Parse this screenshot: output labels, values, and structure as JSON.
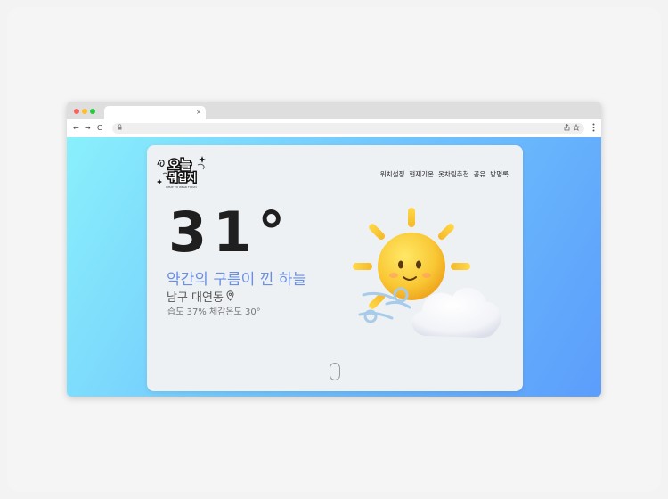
{
  "browser": {
    "tab_close": "×",
    "nav_back": "←",
    "nav_forward": "→",
    "nav_reload": "C",
    "url_icon": "lock-icon",
    "toolbar_icons": [
      "share-icon",
      "star-icon",
      "menu-dots-icon"
    ]
  },
  "site": {
    "logo": {
      "title_line1": "오늘",
      "title_line2": "뭐입지",
      "tagline": "WHAT TO WEAR TODAY"
    },
    "menu": [
      "위치설정",
      "현재기온",
      "옷차림추천",
      "공유",
      "방명록"
    ]
  },
  "weather": {
    "temperature": "31°",
    "condition": "약간의 구름이 낀 하늘",
    "location": "남구 대연동",
    "location_icon": "map-pin-icon",
    "details": "습도 37% 체감온도 30°",
    "illustration": "sun-behind-cloud-with-wind-icon"
  },
  "colors": {
    "gradient_start": "#8af0fc",
    "gradient_end": "#5b9dfc",
    "condition_text": "#6b8fe3",
    "sun": "#f9c734"
  }
}
